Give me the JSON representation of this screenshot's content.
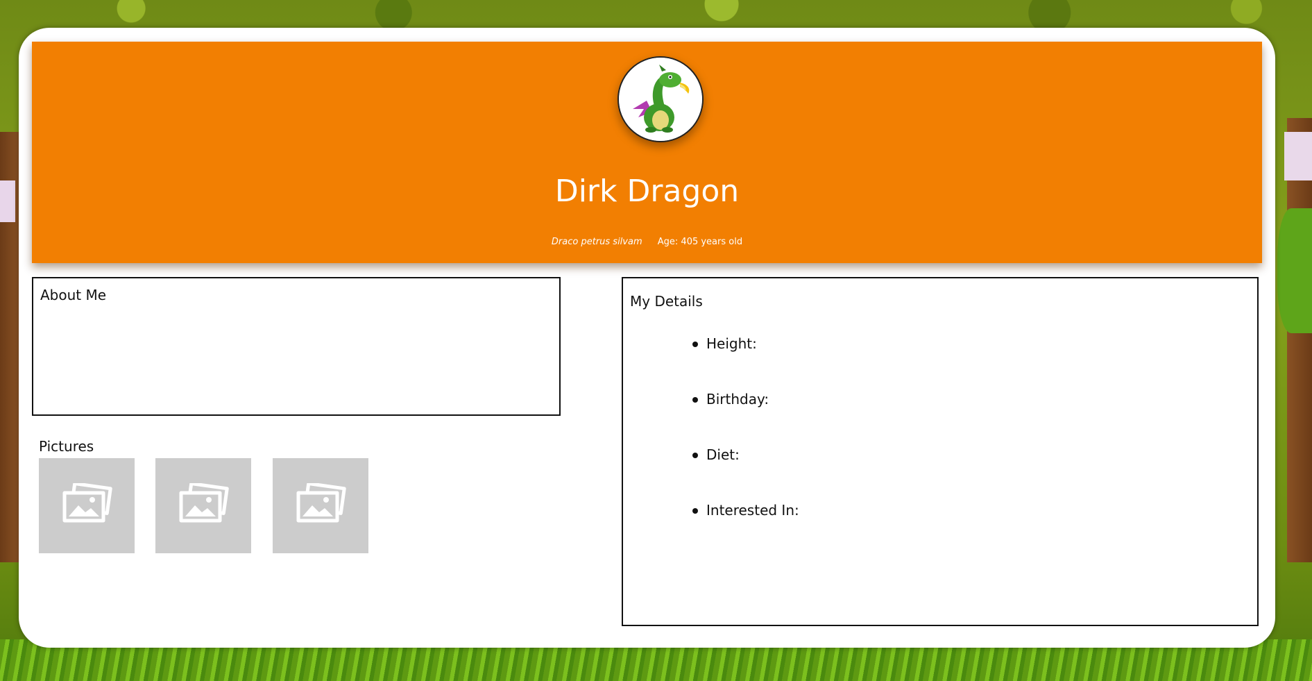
{
  "profile": {
    "name": "Dirk Dragon",
    "species": "Draco petrus silvam",
    "age_text": "Age: 405 years old",
    "avatar_icon": "dragon-avatar-icon"
  },
  "about": {
    "heading": "About Me"
  },
  "pictures": {
    "heading": "Pictures",
    "items": [
      {
        "icon": "image-placeholder-icon"
      },
      {
        "icon": "image-placeholder-icon"
      },
      {
        "icon": "image-placeholder-icon"
      }
    ]
  },
  "details": {
    "heading": "My Details",
    "items": [
      {
        "label": "Height:"
      },
      {
        "label": "Birthday:"
      },
      {
        "label": "Diet:"
      },
      {
        "label": "Interested In:"
      }
    ]
  },
  "colors": {
    "banner": "#f27f02",
    "card": "#ffffff",
    "placeholder": "#cccccc",
    "background": "#7a9618"
  }
}
